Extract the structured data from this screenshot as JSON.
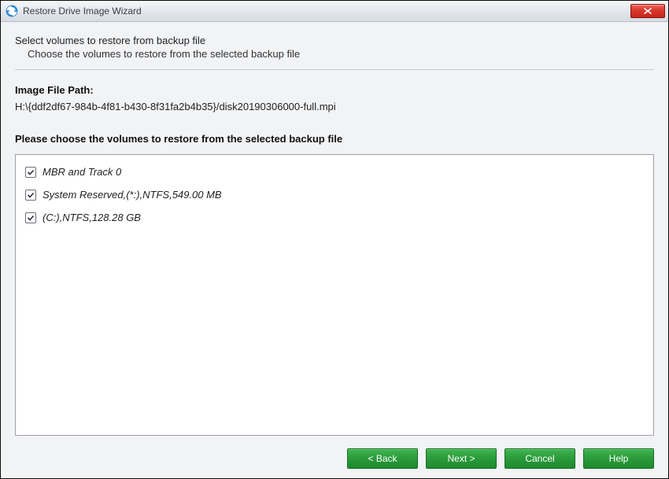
{
  "window": {
    "title": "Restore Drive Image Wizard"
  },
  "header": {
    "title": "Select volumes to restore from backup file",
    "subtitle": "Choose the volumes to restore from the selected backup file"
  },
  "image_path": {
    "label": "Image File Path:",
    "value": "H:\\{ddf2df67-984b-4f81-b430-8f31fa2b4b35}/disk20190306000-full.mpi"
  },
  "volumes": {
    "prompt": "Please choose the volumes to restore from the selected backup file",
    "items": [
      {
        "label": "MBR and Track 0",
        "checked": true
      },
      {
        "label": "System Reserved,(*:),NTFS,549.00 MB",
        "checked": true
      },
      {
        "label": "(C:),NTFS,128.28 GB",
        "checked": true
      }
    ]
  },
  "buttons": {
    "back": "< Back",
    "next": "Next >",
    "cancel": "Cancel",
    "help": "Help"
  },
  "colors": {
    "button_bg": "#2a9a3a",
    "close_bg": "#d83b2d"
  }
}
